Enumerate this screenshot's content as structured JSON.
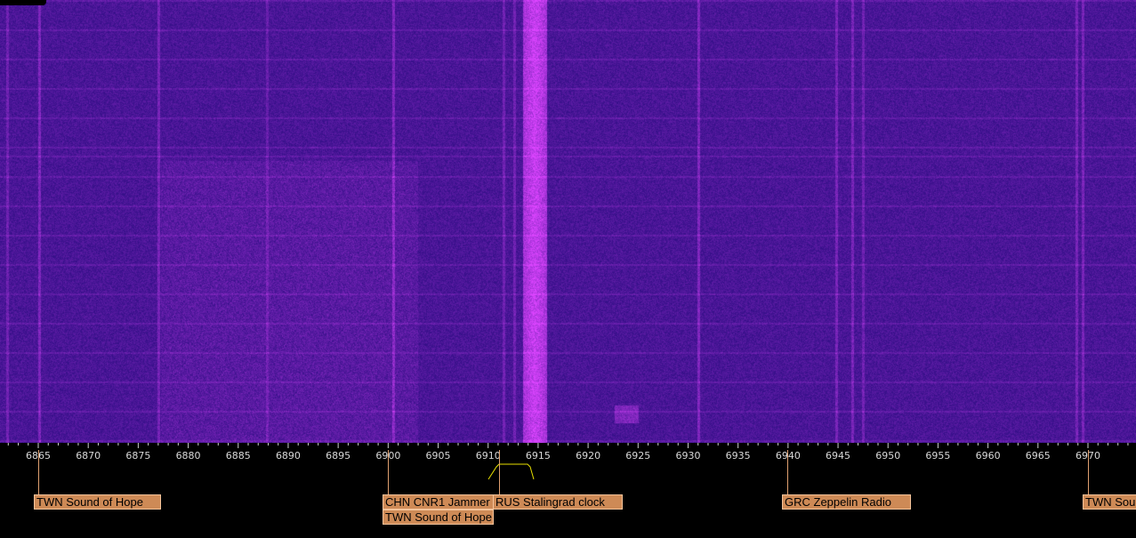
{
  "waterfall": {
    "freq_start_khz": 6865,
    "freq_end_khz": 6975,
    "bg_color": "#2a14a0",
    "signal_color": "#b040ff"
  },
  "scale": {
    "tick_labels": [
      "6865",
      "6870",
      "6875",
      "6880",
      "6885",
      "6890",
      "6895",
      "6900",
      "6905",
      "6910",
      "6915",
      "6920",
      "6925",
      "6930",
      "6935",
      "6940",
      "6945",
      "6950",
      "6955",
      "6960",
      "6965",
      "6970"
    ],
    "passband_color": "#e8e000"
  },
  "stations": [
    {
      "freq": 6865,
      "label": "TWN Sound of Hope"
    },
    {
      "freq": 6900,
      "label": "CHN CNR1 Jammer"
    },
    {
      "freq": 6900,
      "label": "TWN Sound of Hope"
    },
    {
      "freq": 6911,
      "label": "RUS Stalingrad clock"
    },
    {
      "freq": 6940,
      "label": "GRC Zeppelin Radio"
    },
    {
      "freq": 6970,
      "label": "TWN Sound of Hope"
    }
  ]
}
